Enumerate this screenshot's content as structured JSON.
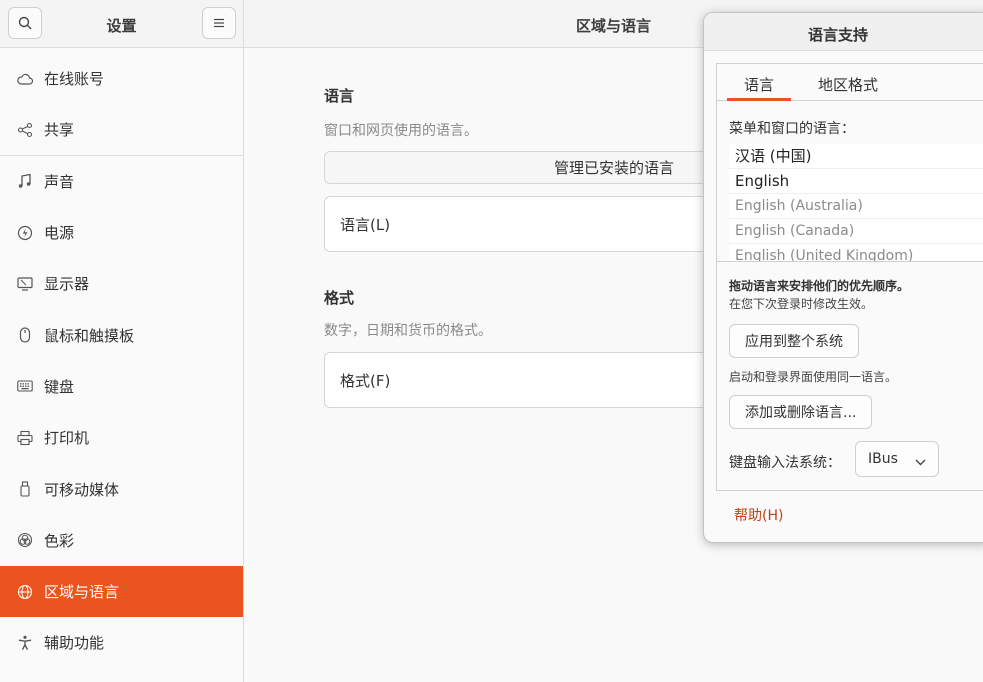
{
  "sidebar": {
    "title": "设置",
    "items": [
      {
        "label": "在线账号",
        "icon": "cloud-icon"
      },
      {
        "label": "共享",
        "icon": "share-icon"
      },
      {
        "label": "声音",
        "icon": "music-note-icon"
      },
      {
        "label": "电源",
        "icon": "power-icon"
      },
      {
        "label": "显示器",
        "icon": "display-icon"
      },
      {
        "label": "鼠标和触摸板",
        "icon": "mouse-icon"
      },
      {
        "label": "键盘",
        "icon": "keyboard-icon"
      },
      {
        "label": "打印机",
        "icon": "printer-icon"
      },
      {
        "label": "可移动媒体",
        "icon": "usb-drive-icon"
      },
      {
        "label": "色彩",
        "icon": "color-icon"
      },
      {
        "label": "区域与语言",
        "icon": "globe-icon",
        "active": true
      },
      {
        "label": "辅助功能",
        "icon": "accessibility-icon"
      }
    ]
  },
  "main": {
    "title": "区域与语言",
    "language_section": {
      "title": "语言",
      "subtitle": "窗口和网页使用的语言。",
      "manage_button": "管理已安装的语言",
      "row_label": "语言(L)"
    },
    "format_section": {
      "title": "格式",
      "subtitle": "数字，日期和货币的格式。",
      "row_label": "格式(F)"
    }
  },
  "dialog": {
    "title": "语言支持",
    "tabs": [
      "语言",
      "地区格式"
    ],
    "menu_label": "菜单和窗口的语言：",
    "languages": [
      "汉语 (中国)",
      "English",
      "English (Australia)",
      "English (Canada)",
      "English (United Kingdom)"
    ],
    "hint_bold": "拖动语言来安排他们的优先顺序。",
    "hint_next_login": "在您下次登录时修改生效。",
    "apply_button": "应用到整个系统",
    "hint_login_screen": "启动和登录界面使用同一语言。",
    "add_remove_button": "添加或删除语言...",
    "ime_label": "键盘输入法系统：",
    "ime_value": "IBus",
    "help_link": "帮助(H)"
  },
  "colors": {
    "accent": "#e95420",
    "link": "#c34113"
  }
}
